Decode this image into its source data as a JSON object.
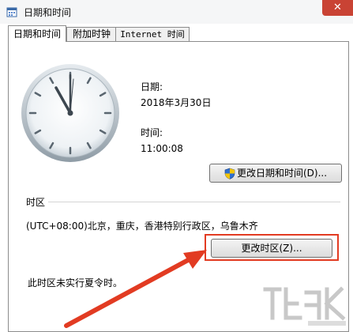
{
  "window": {
    "title": "日期和时间",
    "close_glyph": "✕"
  },
  "tabs": [
    {
      "label": "日期和时间",
      "active": true
    },
    {
      "label": "附加时钟",
      "active": false
    },
    {
      "label": "Internet 时间",
      "active": false
    }
  ],
  "datetime": {
    "date_label": "日期:",
    "date_value": "2018年3月30日",
    "time_label": "时间:",
    "time_value": "11:00:08",
    "change_button": "更改日期和时间(D)..."
  },
  "timezone": {
    "heading": "时区",
    "value": "(UTC+08:00)北京，重庆，香港特别行政区，乌鲁木齐",
    "change_button": "更改时区(Z)...",
    "dst_note": "此时区未实行夏令时。"
  },
  "annotation": {
    "highlight_color": "#e23b22"
  },
  "icons": [
    "calendar-clock-icon",
    "close-icon",
    "analog-clock",
    "uac-shield-icon"
  ]
}
